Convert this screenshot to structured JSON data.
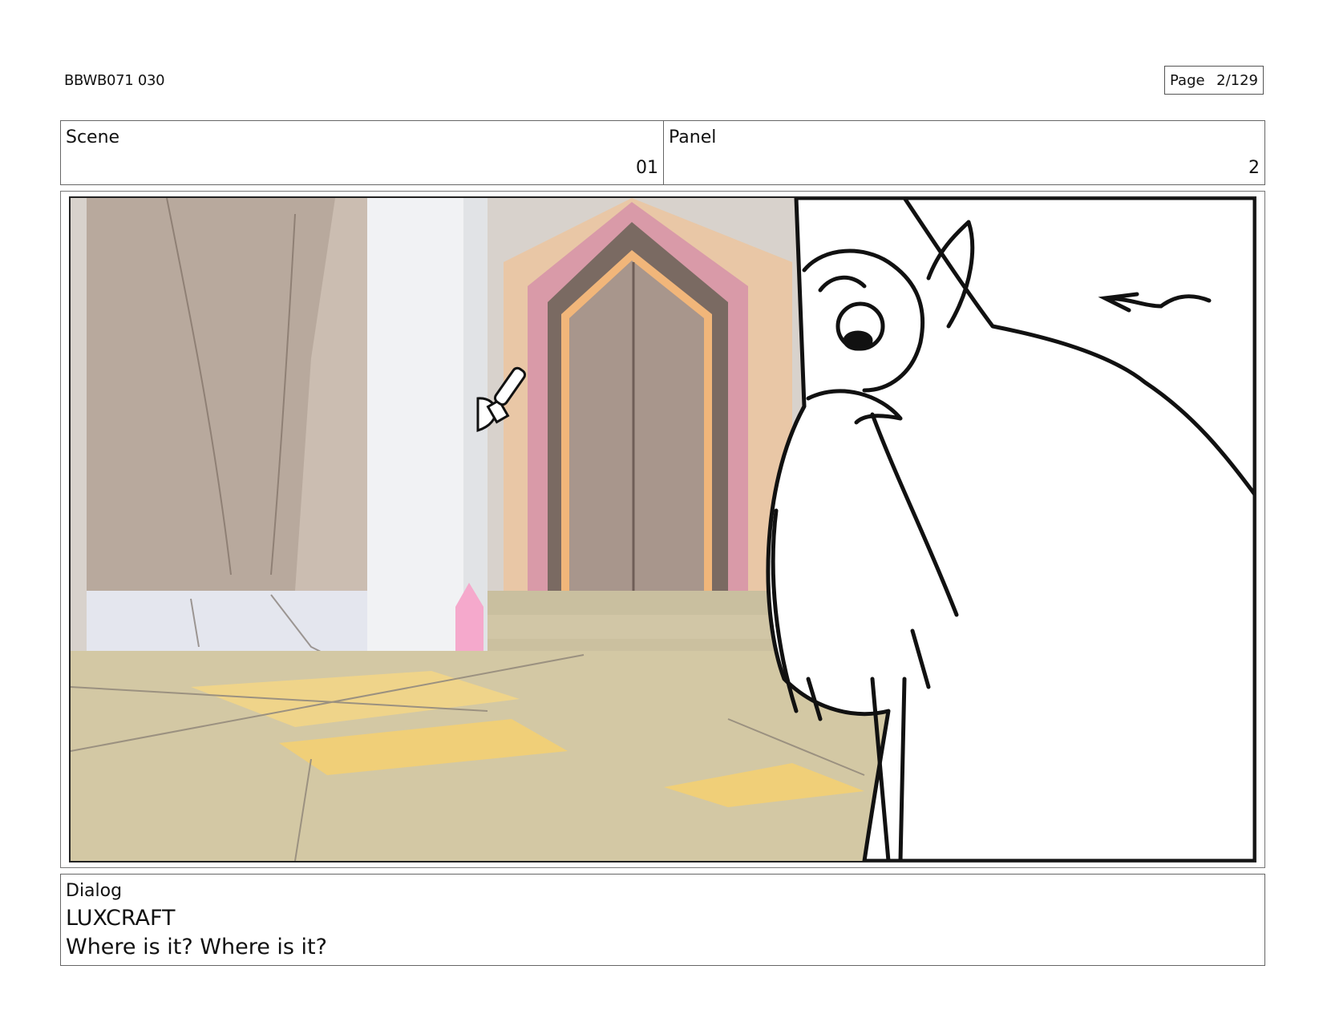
{
  "header": {
    "doc_id": "BBWB071 030",
    "page_label": "Page",
    "page_number": "2/129"
  },
  "info": {
    "scene_label": "Scene",
    "scene_value": "01",
    "panel_label": "Panel",
    "panel_value": "2"
  },
  "dialog": {
    "label": "Dialog",
    "character": "LUXCRAFT",
    "line": "Where is it? Where is it?"
  },
  "colors": {
    "wall": "#b8aa9e",
    "floor": "#d3c8a4",
    "door_pink": "#d99aa8",
    "door_orange": "#f1b67a",
    "door_dark": "#6f5e57",
    "light_yellow": "#f4d27a",
    "crystal_pink": "#f5a9cc"
  }
}
